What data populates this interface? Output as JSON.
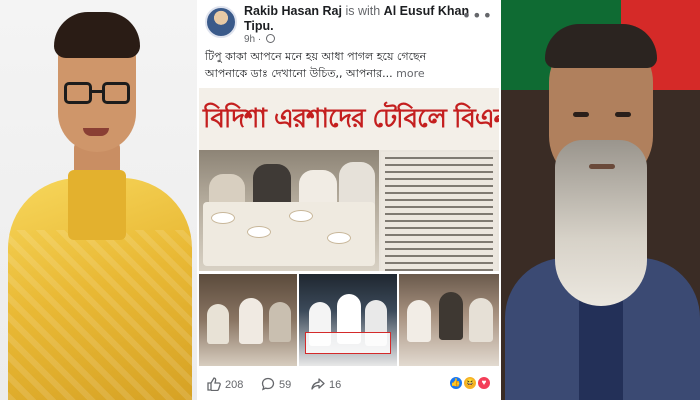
{
  "post": {
    "author": "Rakib Hasan Raj",
    "with_text": "is with",
    "tagged": "Al Eusuf Khan Tipu.",
    "time": "9h",
    "more_icon": "more-horizontal-icon",
    "text_line1": "টিপু কাকা আপনে মনে হয় আধা পাগল হয়ে গেছেন",
    "text_line2": "আপনাকে ডাঃ দেখানো উচিত,, আপনার...",
    "see_more": "more",
    "headline": "বিদিশা এরশাদের টেবিলে বিএনপি নেতা",
    "likes": "208",
    "comments": "59",
    "shares": "16"
  },
  "colors": {
    "headline_red": "#c41f1f",
    "fb_text": "#1c1e21",
    "fb_muted": "#65676b"
  }
}
